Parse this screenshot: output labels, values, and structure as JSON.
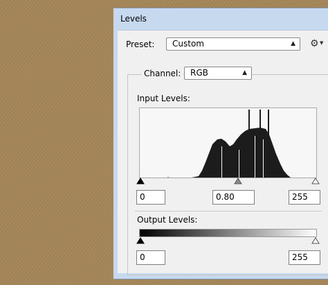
{
  "dialog": {
    "title": "Levels",
    "preset_label": "Preset:",
    "preset_value": "Custom",
    "preset_menu_icon": "gear-icon",
    "channel_label": "Channel:",
    "channel_value": "RGB",
    "input_levels_label": "Input Levels:",
    "input_black": "0",
    "input_gamma": "0.80",
    "input_white": "255",
    "output_levels_label": "Output Levels:",
    "output_black": "0",
    "output_white": "255"
  }
}
